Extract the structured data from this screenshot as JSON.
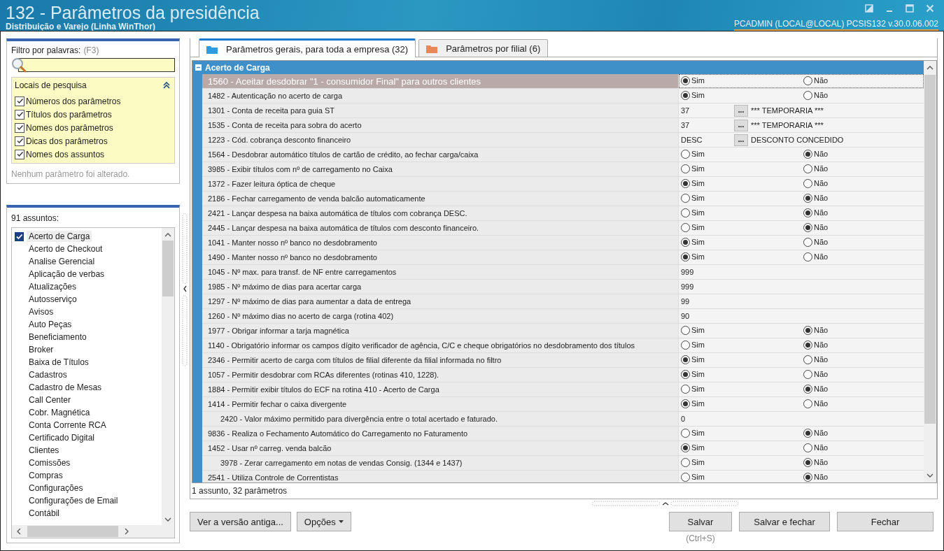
{
  "window": {
    "title": "132 - Parâmetros da presidência",
    "subtitle": "Distribuição e Varejo (Linha WinThor)",
    "user_info": "PCADMIN (LOCAL@LOCAL)  PCSIS132  v.30.0.06.002"
  },
  "filter": {
    "label": "Filtro por palavras:",
    "shortcut": "(F3)",
    "search_places": {
      "title": "Locais de pesquisa",
      "expanded": true,
      "options": [
        {
          "label": "Números dos parâmetros",
          "checked": true
        },
        {
          "label": "Títulos dos parâmetros",
          "checked": true
        },
        {
          "label": "Nomes dos parâmetros",
          "checked": true
        },
        {
          "label": "Dicas dos parâmetros",
          "checked": true
        },
        {
          "label": "Nomes dos assuntos",
          "checked": true
        }
      ]
    },
    "status": "Nenhum parâmetro foi alterado."
  },
  "subjects": {
    "label": "91 assuntos:",
    "items": [
      {
        "label": "Acerto de Carga",
        "selected": true
      },
      {
        "label": "Acerto de Checkout",
        "selected": false
      },
      {
        "label": "Analise Gerencial",
        "selected": false
      },
      {
        "label": "Aplicação de verbas",
        "selected": false
      },
      {
        "label": "Atualizações",
        "selected": false
      },
      {
        "label": "Autosserviço",
        "selected": false
      },
      {
        "label": "Avisos",
        "selected": false
      },
      {
        "label": "Auto Peças",
        "selected": false
      },
      {
        "label": "Beneficiamento",
        "selected": false
      },
      {
        "label": "Broker",
        "selected": false
      },
      {
        "label": "Baixa de Títulos",
        "selected": false
      },
      {
        "label": "Cadastros",
        "selected": false
      },
      {
        "label": "Cadastro de Mesas",
        "selected": false
      },
      {
        "label": "Call Center",
        "selected": false
      },
      {
        "label": "Cobr. Magnética",
        "selected": false
      },
      {
        "label": "Conta Corrente RCA",
        "selected": false
      },
      {
        "label": "Certificado Digital",
        "selected": false
      },
      {
        "label": "Clientes",
        "selected": false
      },
      {
        "label": "Comissões",
        "selected": false
      },
      {
        "label": "Compras",
        "selected": false
      },
      {
        "label": "Configurações",
        "selected": false
      },
      {
        "label": "Configurações de Email",
        "selected": false
      },
      {
        "label": "Contábil",
        "selected": false
      }
    ]
  },
  "tabs": [
    {
      "label": "Parâmetros gerais, para toda a empresa  (32)",
      "selected": true,
      "color": "#2f9be0"
    },
    {
      "label": "Parâmetros por filial  (6)",
      "selected": false,
      "color": "#e8875a"
    }
  ],
  "group": {
    "title": "Acerto de Carga",
    "expanded": true
  },
  "rows": [
    {
      "label": "1560 - Aceitar desdobrar \"1 - consumidor Final\" para outros clientes",
      "selected": true,
      "kind": "choice",
      "options": [
        {
          "label": "Sim",
          "selected": true
        },
        {
          "label": "Não",
          "selected": false
        }
      ]
    },
    {
      "label": "1482 - Autenticação no acerto de carga",
      "selected": false,
      "kind": "choice",
      "options": [
        {
          "label": "Sim",
          "selected": true
        },
        {
          "label": "Não",
          "selected": false
        }
      ]
    },
    {
      "label": "1301 - Conta de receita para guia ST",
      "selected": false,
      "kind": "lookup",
      "value": "37",
      "button": "...",
      "description": "*** TEMPORARIA ***"
    },
    {
      "label": "1535 - Conta de receita para sobra do acerto",
      "selected": false,
      "kind": "lookup",
      "value": "37",
      "button": "...",
      "description": "*** TEMPORARIA ***"
    },
    {
      "label": "1223 - Cód. cobrança desconto financeiro",
      "selected": false,
      "kind": "lookup",
      "value": "DESC",
      "button": "...",
      "description": "DESCONTO CONCEDIDO"
    },
    {
      "label": "1564 - Desdobrar automático títulos de cartão de crédito, ao fechar carga/caixa",
      "selected": false,
      "kind": "choice",
      "options": [
        {
          "label": "Sim",
          "selected": false
        },
        {
          "label": "Não",
          "selected": true
        }
      ]
    },
    {
      "label": "3985 - Exibir títulos com nº de carregamento no Caixa",
      "selected": false,
      "kind": "choice",
      "options": [
        {
          "label": "Sim",
          "selected": false
        },
        {
          "label": "Não",
          "selected": false
        }
      ]
    },
    {
      "label": "1372 - Fazer leitura óptica de cheque",
      "selected": false,
      "kind": "choice",
      "options": [
        {
          "label": "Sim",
          "selected": true
        },
        {
          "label": "Não",
          "selected": false
        }
      ]
    },
    {
      "label": "2186 - Fechar carregamento de venda balcão automaticamente",
      "selected": false,
      "kind": "choice",
      "options": [
        {
          "label": "Sim",
          "selected": false
        },
        {
          "label": "Não",
          "selected": true
        }
      ]
    },
    {
      "label": "2421 - Lançar despesa na baixa automática de títulos com cobrança DESC.",
      "selected": false,
      "kind": "choice",
      "options": [
        {
          "label": "Sim",
          "selected": false
        },
        {
          "label": "Não",
          "selected": true
        }
      ]
    },
    {
      "label": "2445 - Lançar despesa na baixa automática de títulos com desconto financeiro.",
      "selected": false,
      "kind": "choice",
      "options": [
        {
          "label": "Sim",
          "selected": false
        },
        {
          "label": "Não",
          "selected": true
        }
      ]
    },
    {
      "label": "1041 - Manter nosso nº banco no desdobramento",
      "selected": false,
      "kind": "choice",
      "options": [
        {
          "label": "Sim",
          "selected": true
        },
        {
          "label": "Não",
          "selected": false
        }
      ]
    },
    {
      "label": "1490 - Manter nosso nº banco no desdobramento",
      "selected": false,
      "kind": "choice",
      "options": [
        {
          "label": "Sim",
          "selected": true
        },
        {
          "label": "Não",
          "selected": false
        }
      ]
    },
    {
      "label": "1045 - Nº max. para transf. de NF entre carregamentos",
      "selected": false,
      "kind": "value",
      "value": "999"
    },
    {
      "label": "1985 - Nº máximo de dias para acertar carga",
      "selected": false,
      "kind": "value",
      "value": "999"
    },
    {
      "label": "1297 - Nº máximo de dias para aumentar a data de entrega",
      "selected": false,
      "kind": "value",
      "value": "99"
    },
    {
      "label": "1260 - Nº máximo dias no acerto de carga (rotina 402)",
      "selected": false,
      "kind": "value",
      "value": "90"
    },
    {
      "label": "1977 - Obrigar informar a tarja magnética",
      "selected": false,
      "kind": "choice",
      "options": [
        {
          "label": "Sim",
          "selected": false
        },
        {
          "label": "Não",
          "selected": true
        }
      ]
    },
    {
      "label": "1140 - Obrigatório informar os campos dígito verificador de agência, C/C e cheque obrigatórios no desdobramento dos títulos",
      "selected": false,
      "kind": "choice",
      "options": [
        {
          "label": "Sim",
          "selected": false
        },
        {
          "label": "Não",
          "selected": true
        }
      ]
    },
    {
      "label": "2346 - Permitir acerto de carga com títulos de filial diferente da filial informada no filtro",
      "selected": false,
      "kind": "choice",
      "options": [
        {
          "label": "Sim",
          "selected": true
        },
        {
          "label": "Não",
          "selected": false
        }
      ]
    },
    {
      "label": "1057 - Permitir desdobrar com RCAs diferentes (rotinas 410, 1228).",
      "selected": false,
      "kind": "choice",
      "options": [
        {
          "label": "Sim",
          "selected": true
        },
        {
          "label": "Não",
          "selected": false
        }
      ]
    },
    {
      "label": "1884 - Permitir exibir títulos do ECF na rotina 410 - Acerto de Carga",
      "selected": false,
      "kind": "choice",
      "options": [
        {
          "label": "Sim",
          "selected": false
        },
        {
          "label": "Não",
          "selected": true
        }
      ]
    },
    {
      "label": "1414 - Permitir fechar o caixa divergente",
      "selected": false,
      "kind": "choice",
      "options": [
        {
          "label": "Sim",
          "selected": true
        },
        {
          "label": "Não",
          "selected": false
        }
      ],
      "children": [
        {
          "label": "2420 - Valor máximo permitido para divergência entre o total acertado e faturado.",
          "selected": false,
          "kind": "value",
          "value": "0"
        }
      ]
    },
    {
      "label": "9836 - Realiza o Fechamento Automático do Carregamento no Faturamento",
      "selected": false,
      "kind": "choice",
      "options": [
        {
          "label": "Sim",
          "selected": false
        },
        {
          "label": "Não",
          "selected": true
        }
      ]
    },
    {
      "label": "1452 - Usar nº carreg. venda balcão",
      "selected": false,
      "kind": "choice",
      "options": [
        {
          "label": "Sim",
          "selected": true
        },
        {
          "label": "Não",
          "selected": false
        }
      ],
      "children": [
        {
          "label": "3978 - Zerar carregamento em notas de vendas Consig. (1344 e 1437)",
          "selected": false,
          "kind": "choice",
          "options": [
            {
              "label": "Sim",
              "selected": false
            },
            {
              "label": "Não",
              "selected": true
            }
          ]
        }
      ]
    },
    {
      "label": "2541 - Utiliza Controle de Correntistas",
      "selected": false,
      "kind": "choice",
      "options": [
        {
          "label": "Sim",
          "selected": false
        },
        {
          "label": "Não",
          "selected": true
        }
      ]
    }
  ],
  "table_status": "1 assunto, 32 parâmetros",
  "left_buttons": [
    {
      "label": "Ver a versão antiga...",
      "kind": "plain"
    },
    {
      "label": "Opções",
      "kind": "menu"
    }
  ],
  "right_buttons": [
    {
      "label": "Salvar",
      "hint": "(Ctrl+S)"
    },
    {
      "label": "Salvar e fechar"
    },
    {
      "label": "Fechar"
    }
  ]
}
